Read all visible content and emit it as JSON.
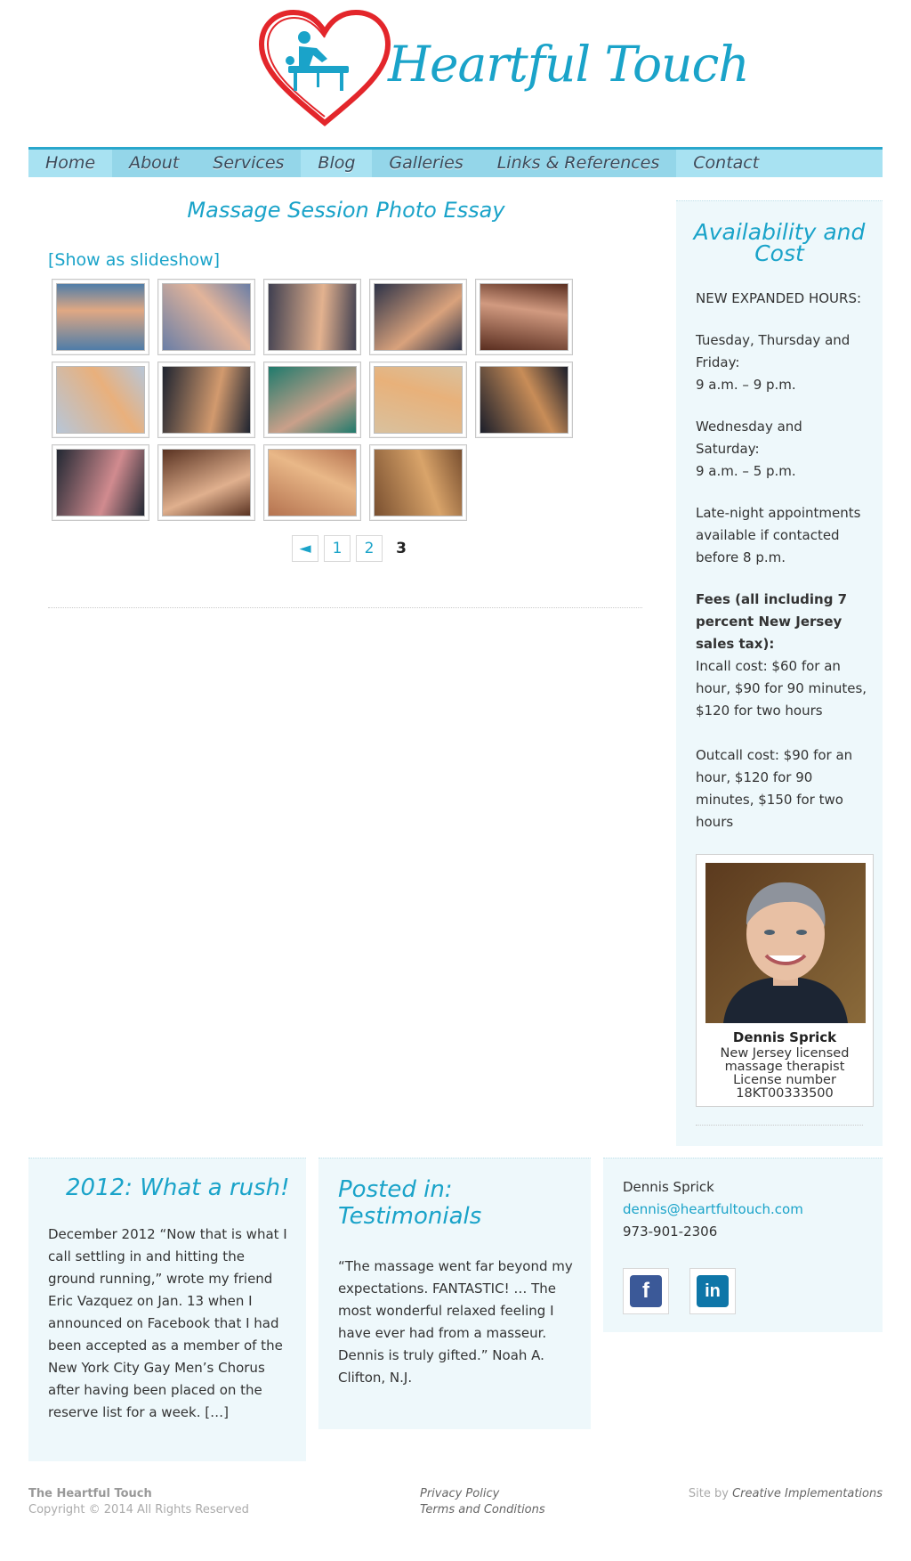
{
  "site": {
    "name": "Heartful Touch"
  },
  "nav": [
    "Home",
    "About",
    "Services",
    "Blog",
    "Galleries",
    "Links & References",
    "Contact"
  ],
  "main": {
    "title": "Massage Session Photo Essay",
    "slideshow_link": "[Show as slideshow]",
    "thumbnails": [
      {
        "name": "thumb-1",
        "palette": [
          "#4f7da8",
          "#e0a883"
        ]
      },
      {
        "name": "thumb-2",
        "palette": [
          "#6a7ea6",
          "#e2b49a"
        ]
      },
      {
        "name": "thumb-3",
        "palette": [
          "#3f3f50",
          "#e3b28f"
        ]
      },
      {
        "name": "thumb-4",
        "palette": [
          "#2e3348",
          "#d9a27c"
        ]
      },
      {
        "name": "thumb-5",
        "palette": [
          "#5a2e20",
          "#d19a80"
        ]
      },
      {
        "name": "thumb-6",
        "palette": [
          "#b7c6d8",
          "#e9b07c"
        ]
      },
      {
        "name": "thumb-7",
        "palette": [
          "#1f2430",
          "#d29a6e"
        ]
      },
      {
        "name": "thumb-8",
        "palette": [
          "#1f7a6c",
          "#caa08a"
        ]
      },
      {
        "name": "thumb-9",
        "palette": [
          "#d9c19e",
          "#e8b17a"
        ]
      },
      {
        "name": "thumb-10",
        "palette": [
          "#1b1e2a",
          "#c88d58"
        ]
      },
      {
        "name": "thumb-11",
        "palette": [
          "#222833",
          "#d18b8f"
        ]
      },
      {
        "name": "thumb-12",
        "palette": [
          "#5a3322",
          "#e0b08e"
        ]
      },
      {
        "name": "thumb-13",
        "palette": [
          "#b57350",
          "#e9b888"
        ]
      },
      {
        "name": "thumb-14",
        "palette": [
          "#7a5030",
          "#d9a46a"
        ]
      }
    ],
    "pager": {
      "prev": "◄",
      "pages": [
        "1",
        "2"
      ],
      "current": "3"
    }
  },
  "sidebar": {
    "title": "Availability and Cost",
    "hours_heading": "NEW EXPANDED HOURS:",
    "days_1": "Tuesday, Thursday and Friday:",
    "hours_1": "9 a.m. – 9 p.m.",
    "days_2": "Wednesday and Saturday:",
    "hours_2": "9 a.m. – 5 p.m.",
    "late_night": "Late-night appointments available if  contacted before 8 p.m.",
    "fees_heading": "Fees (all including 7 percent New Jersey sales tax):",
    "incall": "Incall cost: $60 for an hour, $90 for 90 minutes, $120 for two hours",
    "outcall": "Outcall cost: $90 for an hour, $120 for 90 minutes, $150 for two hours",
    "profile": {
      "name": "Dennis Sprick",
      "line1": "New Jersey licensed",
      "line2": "massage therapist",
      "line3": "License number",
      "line4": "18KT00333500"
    }
  },
  "footer": {
    "blog": {
      "title": "2012: What a rush!",
      "text": "December 2012 “Now that is what I call settling in and hitting the ground running,” wrote my friend Eric Vazquez on Jan. 13 when I announced on Facebook that I had been accepted as a member of the New York City Gay Men’s Chorus after having been placed on the reserve list for a week. […]"
    },
    "testimonial": {
      "title": "Posted in: Testimonials",
      "text": "“The massage went far beyond my expectations. FANTASTIC! … The most wonderful relaxed feeling I have ever had from a masseur. Dennis is truly gifted.” Noah A. Clifton, N.J."
    },
    "contact": {
      "name": "Dennis Sprick",
      "email": "dennis@heartfultouch.com",
      "phone": "973-901-2306",
      "facebook_icon": "f",
      "linkedin_icon": "in"
    },
    "bottom": {
      "site": "The Heartful Touch",
      "copyright": "Copyright © 2014 All Rights Reserved",
      "privacy": "Privacy Policy",
      "terms": "Terms and Conditions",
      "credit_prefix": "Site by",
      "credit_link": "Creative Implementations"
    }
  },
  "colors": {
    "accent": "#1aa3c9",
    "nav_bg": "#a8e2f2",
    "panel_bg": "#eef8fb",
    "heart": "#e3262b",
    "facebook": "#3b5998",
    "linkedin": "#0e76a8"
  }
}
